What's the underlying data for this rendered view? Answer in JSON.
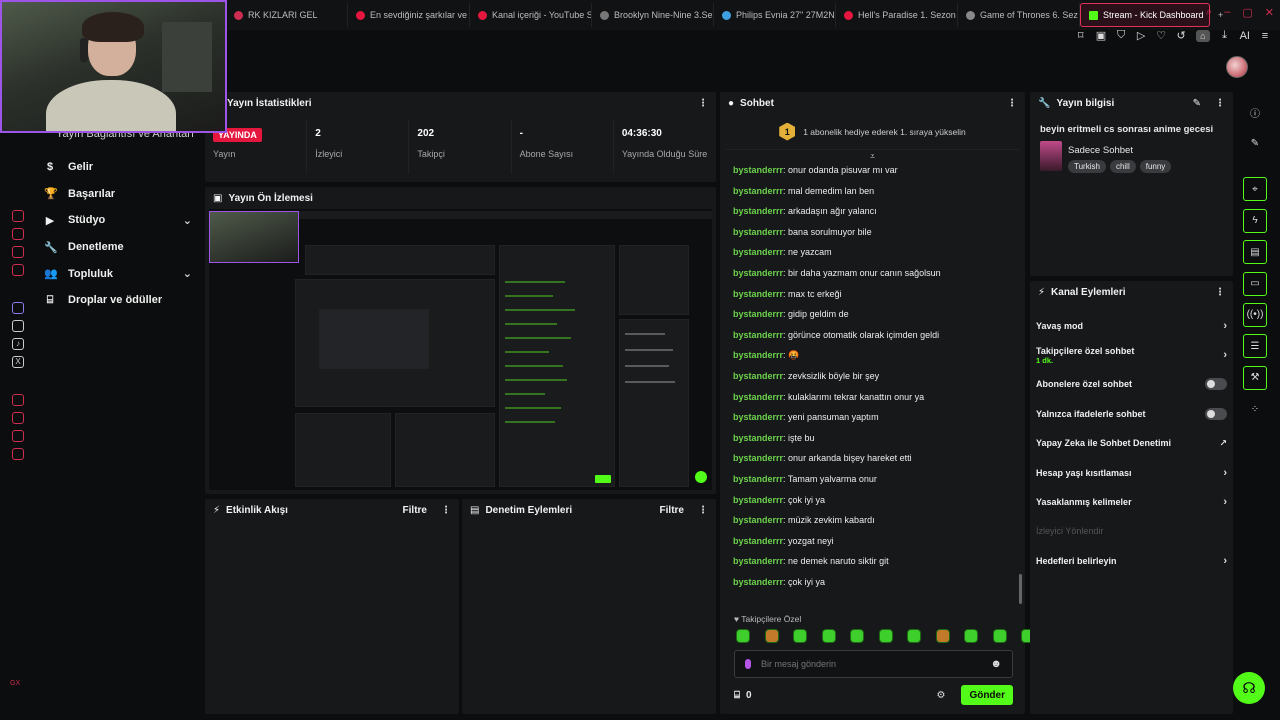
{
  "browser": {
    "tabs": [
      {
        "label": "RK KIZLARI GEL",
        "color": "#cc2d50"
      },
      {
        "label": "En sevdiğiniz şarkılar ve",
        "color": "#e5173f"
      },
      {
        "label": "Kanal içeriği - YouTube S",
        "color": "#e5173f"
      },
      {
        "label": "Brooklyn Nine-Nine 3.Se",
        "color": "#777777"
      },
      {
        "label": "Philips Evnia 27\" 27M2N",
        "color": "#3ea0e0"
      },
      {
        "label": "Hell's Paradise 1. Sezon",
        "color": "#e5173f"
      },
      {
        "label": "Game of Thrones 6. Sez",
        "color": "#888888"
      },
      {
        "label": "Stream - Kick Dashboard",
        "color": "#53fc18"
      }
    ],
    "new_tab": "+",
    "toolbar_ai": "AI"
  },
  "leftnav": {
    "ghost_item": "Yayın Bağlantısı ve Anahtarı",
    "items": [
      {
        "label": "Gelir",
        "icon": "dollar-icon"
      },
      {
        "label": "Başarılar",
        "icon": "trophy-icon"
      },
      {
        "label": "Stüdyo",
        "icon": "video-icon",
        "expandable": true
      },
      {
        "label": "Denetleme",
        "icon": "wrench-icon"
      },
      {
        "label": "Topluluk",
        "icon": "users-icon",
        "expandable": true
      },
      {
        "label": "Droplar ve ödüller",
        "icon": "gift-icon"
      }
    ]
  },
  "stats": {
    "title": "Yayın İstatistikleri",
    "items": [
      {
        "value": "YAYINDA",
        "label": "Yayın"
      },
      {
        "value": "2",
        "label": "İzleyici"
      },
      {
        "value": "202",
        "label": "Takipçi"
      },
      {
        "value": "-",
        "label": "Abone Sayısı"
      },
      {
        "value": "04:36:30",
        "label": "Yayında Olduğu Süre"
      }
    ]
  },
  "preview": {
    "title": "Yayın Ön İzlemesi"
  },
  "events": {
    "title": "Etkinlik Akışı",
    "filter": "Filtre"
  },
  "modactions": {
    "title": "Denetim Eylemleri",
    "filter": "Filtre"
  },
  "chat": {
    "title": "Sohbet",
    "pinned_rank": "1",
    "pinned_text": "1 abonelik hediye ederek 1. sıraya yükselin",
    "messages": [
      {
        "user": "bystanderrr",
        "text": "onur odanda pisuvar mı var"
      },
      {
        "user": "bystanderrr",
        "text": "mal demedim lan ben"
      },
      {
        "user": "bystanderrr",
        "text": "arkadaşın ağır yalancı"
      },
      {
        "user": "bystanderrr",
        "text": "bana sorulmuyor bile"
      },
      {
        "user": "bystanderrr",
        "text": "ne yazcam"
      },
      {
        "user": "bystanderrr",
        "text": "bir daha yazmam onur canın sağolsun"
      },
      {
        "user": "bystanderrr",
        "text": "max tc erkeği"
      },
      {
        "user": "bystanderrr",
        "text": "gidip geldim de"
      },
      {
        "user": "bystanderrr",
        "text": "görünce otomatik olarak içimden geldi"
      },
      {
        "user": "bystanderrr",
        "text": "🤬"
      },
      {
        "user": "bystanderrr",
        "text": "zevksizlik böyle bir şey"
      },
      {
        "user": "bystanderrr",
        "text": "kulaklarımı tekrar kanattın onur ya"
      },
      {
        "user": "bystanderrr",
        "text": "yeni pansuman yaptım"
      },
      {
        "user": "bystanderrr",
        "text": "işte bu"
      },
      {
        "user": "bystanderrr",
        "text": "onur arkanda bişey hareket etti"
      },
      {
        "user": "bystanderrr",
        "text": "Tamam yalvarma onur"
      },
      {
        "user": "bystanderrr",
        "text": "çok iyi ya"
      },
      {
        "user": "bystanderrr",
        "text": "müzik zevkim kabardı"
      },
      {
        "user": "bystanderrr",
        "text": "yozgat neyi"
      },
      {
        "user": "bystanderrr",
        "text": "ne demek naruto siktir git"
      },
      {
        "user": "bystanderrr",
        "text": "çok iyi ya"
      }
    ],
    "emotes_label": "♥ Takipçilere Özel",
    "input_placeholder": "Bir mesaj gönderin",
    "points": "0",
    "send": "Gönder"
  },
  "streaminfo": {
    "title": "Yayın bilgisi",
    "stream_title": "beyin eritmeli cs sonrası anime gecesi",
    "category": "Sadece Sohbet",
    "tags": [
      "Turkish",
      "chill",
      "funny"
    ]
  },
  "chanactions": {
    "title": "Kanal Eylemleri",
    "rows": [
      {
        "label": "Yavaş mod",
        "type": "chevron"
      },
      {
        "label": "Takipçilere özel sohbet",
        "sub": "1 dk.",
        "type": "chevron"
      },
      {
        "label": "Abonelere özel sohbet",
        "type": "toggle"
      },
      {
        "label": "Yalnızca ifadelerle sohbet",
        "type": "toggle"
      },
      {
        "label": "Yapay Zeka ile Sohbet Denetimi",
        "type": "external"
      },
      {
        "label": "Hesap yaşı kısıtlaması",
        "type": "chevron"
      },
      {
        "label": "Yasaklanmış kelimeler",
        "type": "chevron"
      },
      {
        "label": "İzleyici Yönlendir",
        "type": "disabled"
      },
      {
        "label": "Hedefleri belirleyin",
        "type": "chevron"
      }
    ]
  },
  "colors": {
    "accent": "#53fc18",
    "live": "#e5173f",
    "webcam_border": "#9d55e8"
  }
}
